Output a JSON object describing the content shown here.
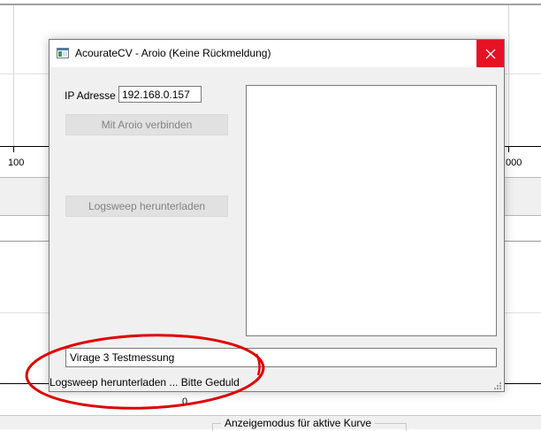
{
  "background": {
    "axis_labels": {
      "left": "100",
      "right": ".000",
      "bottom": "0"
    },
    "display_mode_group_label": "Anzeigemodus für aktive Kurve"
  },
  "dialog": {
    "title": "AcourateCV - Aroio (Keine Rückmeldung)",
    "close_glyph": "×",
    "ip_label": "IP Adresse",
    "ip_value": "192.168.0.157",
    "connect_button_label": "Mit Aroio verbinden",
    "logsweep_button_label": "Logsweep herunterladen",
    "log_text": "",
    "measurement_name": "Virage 3 Testmessung",
    "status_text": "Logsweep herunterladen ... Bitte Geduld",
    "buttons_enabled": false
  },
  "colors": {
    "close_button": "#e81123",
    "annotation": "#e00000",
    "dialog_background": "#f0f0f0"
  },
  "icons": [
    "app-window-icon",
    "close-icon",
    "resize-grip-icon"
  ]
}
